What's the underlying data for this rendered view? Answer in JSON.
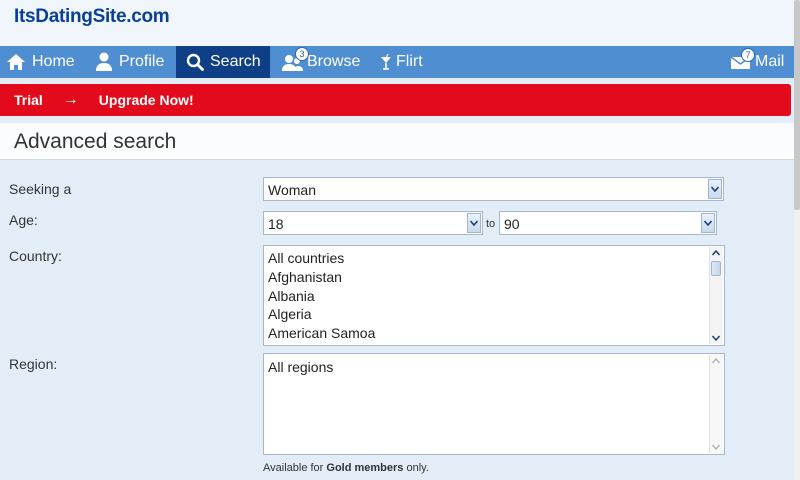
{
  "site": {
    "logo": "ItsDatingSite.com"
  },
  "nav": {
    "home": "Home",
    "profile": "Profile",
    "search": "Search",
    "browse": "Browse",
    "browse_badge": "3",
    "flirt": "Flirt",
    "mail": "Mail",
    "mail_badge": "7"
  },
  "upgrade": {
    "trial": "Trial",
    "arrow": "→",
    "cta": "Upgrade Now!"
  },
  "page": {
    "title": "Advanced search"
  },
  "form": {
    "seeking_label": "Seeking a",
    "seeking_value": "Woman",
    "age_label": "Age:",
    "age_from": "18",
    "age_to_word": "to",
    "age_to": "90",
    "country_label": "Country:",
    "countries": [
      "All countries",
      "Afghanistan",
      "Albania",
      "Algeria",
      "American Samoa"
    ],
    "region_label": "Region:",
    "regions": [
      "All regions"
    ],
    "note_prefix": "Available for ",
    "note_bold": "Gold members",
    "note_suffix": " only."
  },
  "colors": {
    "nav_bg": "#4f8ed0",
    "nav_active": "#0f3f86",
    "upgrade_bg": "#e30b1b",
    "logo": "#0a3f99"
  }
}
